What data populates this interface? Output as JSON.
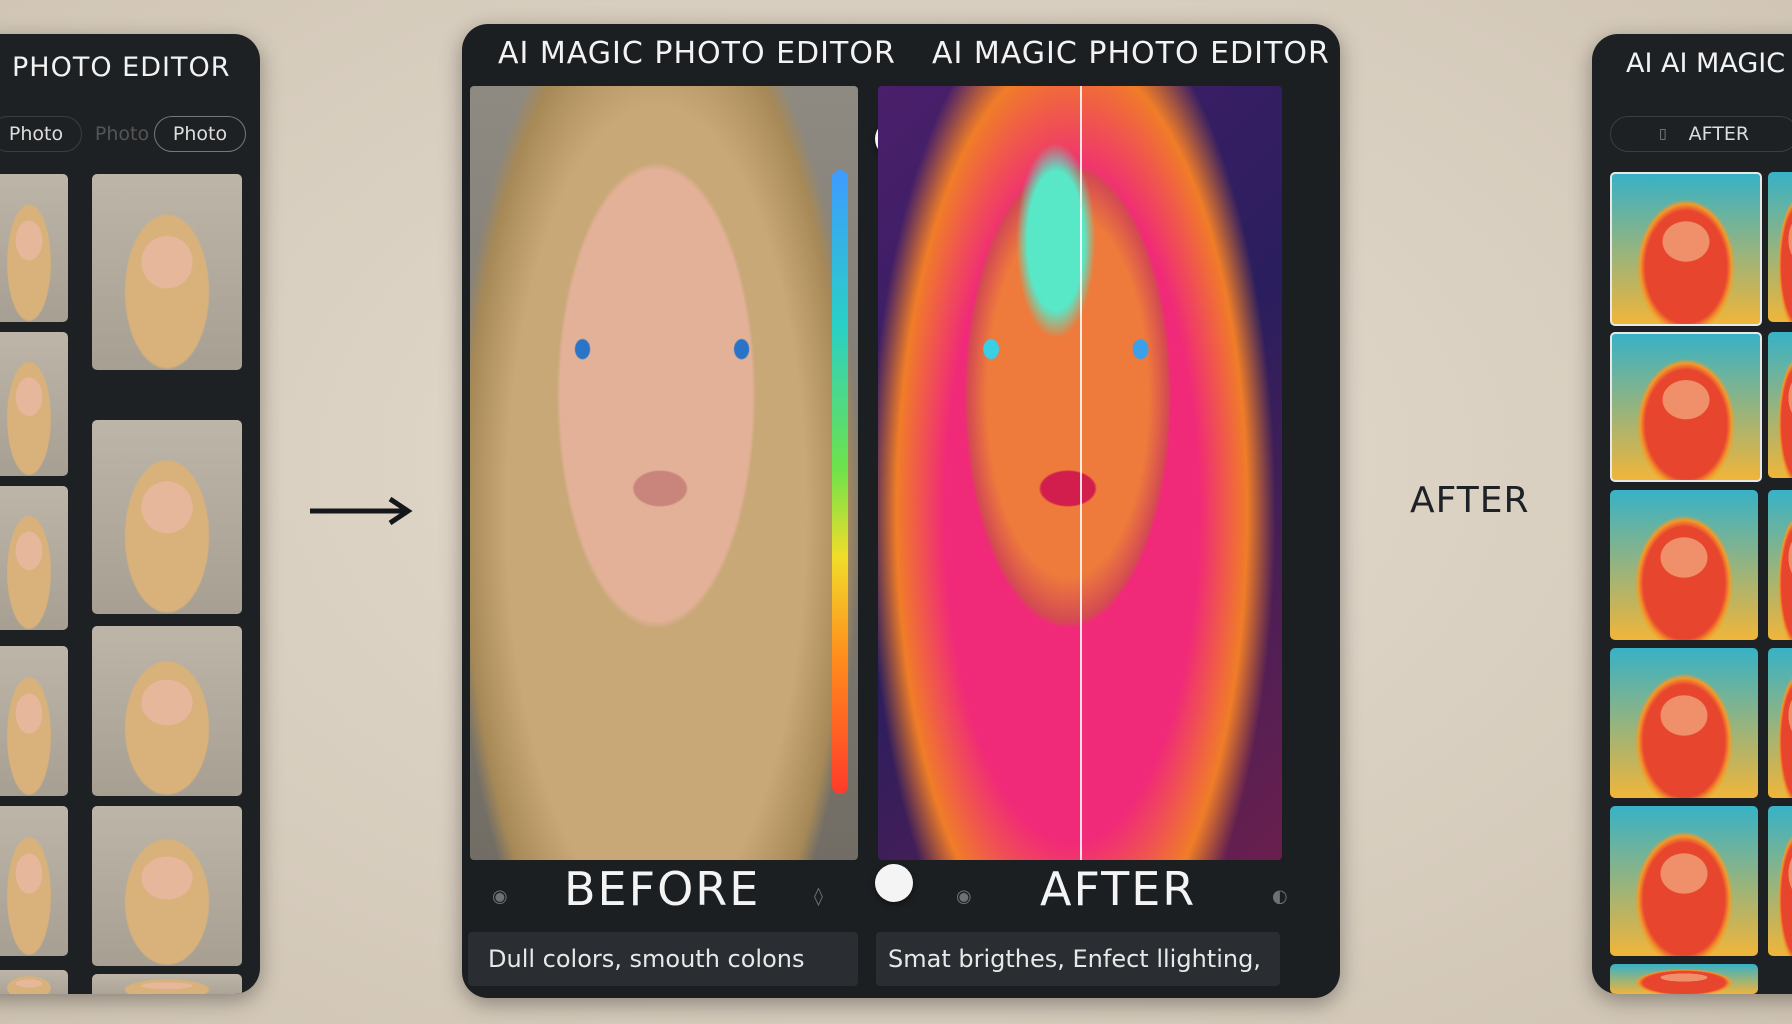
{
  "left_panel": {
    "title": "PHOTO EDITOR",
    "tabs": [
      "Photo",
      "Photo",
      "Photo"
    ]
  },
  "main": {
    "title_before": "AI MAGIC PHOTO EDITOR",
    "title_after": "AI MAGIC PHOTO EDITOR",
    "before_label": "BEFORE",
    "after_label": "AFTER",
    "before_caption": "Dull colors, smouth colons",
    "after_caption": "Smat brigthes, Enfect llighting,",
    "comparison_position": 0.5
  },
  "side_label": "AFTER",
  "right_panel": {
    "title": "AI AI MAGIC",
    "tab_label": "AFTER"
  },
  "colors": {
    "panel": "#1e2124",
    "background": "#ddd3c5",
    "slider_top": "#3e9bff",
    "slider_bottom": "#ff3b2a"
  }
}
